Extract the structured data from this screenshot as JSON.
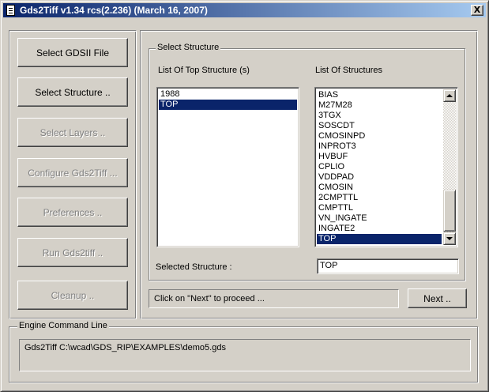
{
  "window": {
    "title": "Gds2Tiff v1.34 rcs(2.236) (March 16, 2007)",
    "close_glyph": "X"
  },
  "sidebar": {
    "buttons": [
      {
        "label": "Select GDSII File",
        "enabled": true
      },
      {
        "label": "Select Structure ..",
        "enabled": true
      },
      {
        "label": "Select Layers ..",
        "enabled": false
      },
      {
        "label": "Configure Gds2Tiff ...",
        "enabled": false
      },
      {
        "label": "Preferences ..",
        "enabled": false
      },
      {
        "label": "Run Gds2tiff ..",
        "enabled": false
      },
      {
        "label": "Cleanup ..",
        "enabled": false
      }
    ]
  },
  "structure_group": {
    "legend": "Select Structure",
    "top_list_label": "List Of Top Structure (s)",
    "all_list_label": "List Of Structures",
    "top_structures": [
      {
        "name": "1988",
        "selected": false
      },
      {
        "name": "TOP",
        "selected": true
      }
    ],
    "structures": [
      {
        "name": "BIAS",
        "selected": false
      },
      {
        "name": "M27M28",
        "selected": false
      },
      {
        "name": "3TGX",
        "selected": false
      },
      {
        "name": "SOSCDT",
        "selected": false
      },
      {
        "name": "CMOSINPD",
        "selected": false
      },
      {
        "name": "INPROT3",
        "selected": false
      },
      {
        "name": "HVBUF",
        "selected": false
      },
      {
        "name": "CPLIO",
        "selected": false
      },
      {
        "name": "VDDPAD",
        "selected": false
      },
      {
        "name": "CMOSIN",
        "selected": false
      },
      {
        "name": "2CMPTTL",
        "selected": false
      },
      {
        "name": "CMPTTL",
        "selected": false
      },
      {
        "name": "VN_INGATE",
        "selected": false
      },
      {
        "name": "INGATE2",
        "selected": false
      },
      {
        "name": "TOP",
        "selected": true
      }
    ],
    "selected_label": "Selected Structure :",
    "selected_value": "TOP"
  },
  "status": {
    "message": "Click on \"Next\" to proceed ...",
    "next_label": "Next .."
  },
  "engine": {
    "legend": "Engine Command Line",
    "command": "Gds2Tiff C:\\wcad\\GDS_RIP\\EXAMPLES\\demo5.gds"
  },
  "colors": {
    "face": "#d4d0c8",
    "selection": "#0a246a",
    "title_gradient_start": "#0a246a",
    "title_gradient_end": "#a6caf0"
  }
}
